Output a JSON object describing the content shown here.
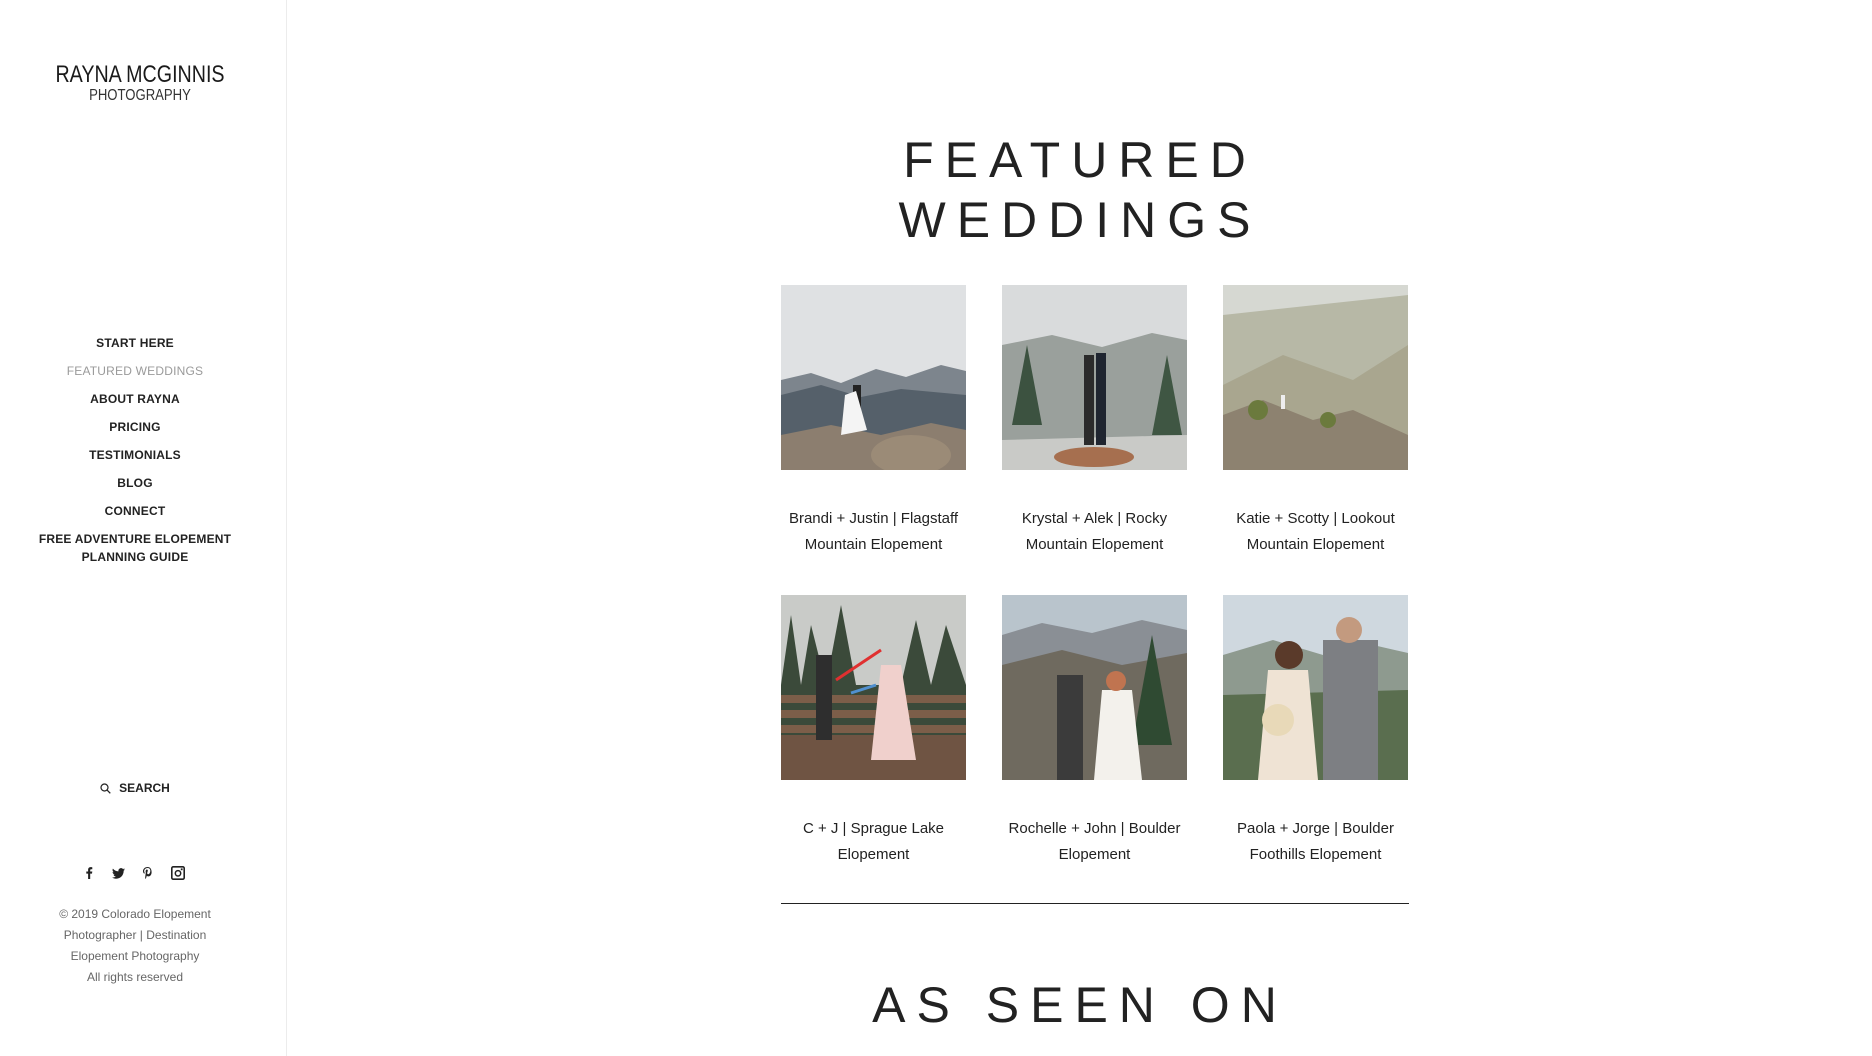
{
  "brand": {
    "name": "RAYNA MCGINNIS",
    "sub": "PHOTOGRAPHY"
  },
  "nav": {
    "items": [
      {
        "label": "START HERE"
      },
      {
        "label": "FEATURED WEDDINGS"
      },
      {
        "label": "ABOUT RAYNA"
      },
      {
        "label": "PRICING"
      },
      {
        "label": "TESTIMONIALS"
      },
      {
        "label": "BLOG"
      },
      {
        "label": "CONNECT"
      },
      {
        "label_line1": "FREE ADVENTURE ELOPEMENT",
        "label_line2": "PLANNING GUIDE"
      }
    ],
    "active_index": 1
  },
  "search": {
    "label": "SEARCH",
    "icon": "search-icon"
  },
  "social": {
    "icons": [
      "facebook-icon",
      "twitter-icon",
      "pinterest-icon",
      "instagram-icon"
    ]
  },
  "footer": {
    "line1": "© 2019 Colorado Elopement",
    "line2": "Photographer | Destination",
    "line3": "Elopement Photography",
    "line4": "All rights reserved"
  },
  "main": {
    "heading_line1": "FEATURED",
    "heading_line2": "WEDDINGS",
    "weddings": [
      {
        "line1": "Brandi + Justin | Flagstaff",
        "line2": "Mountain Elopement"
      },
      {
        "line1": "Krystal + Alek | Rocky",
        "line2": "Mountain Elopement"
      },
      {
        "line1": "Katie + Scotty | Lookout",
        "line2": "Mountain Elopement"
      },
      {
        "line1": "C + J | Sprague Lake",
        "line2": "Elopement"
      },
      {
        "line1": "Rochelle + John | Boulder",
        "line2": "Elopement"
      },
      {
        "line1": "Paola + Jorge | Boulder",
        "line2": "Foothills Elopement"
      }
    ],
    "section2_heading": "AS SEEN ON"
  }
}
